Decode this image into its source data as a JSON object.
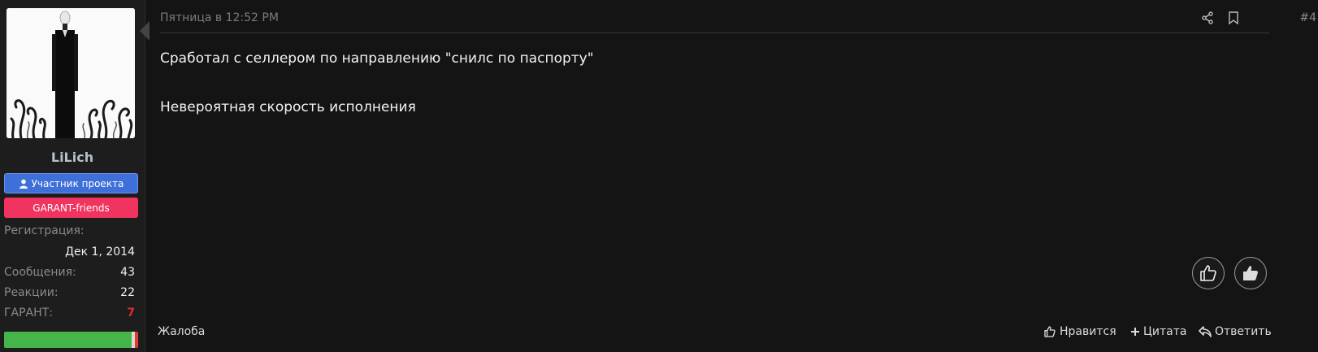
{
  "user": {
    "name": "LiLich",
    "banners": {
      "member_label": "Участник проекта",
      "garant_label": "GARANT-friends"
    },
    "stats": {
      "registration_label": "Регистрация:",
      "registration_value": "Дек 1, 2014",
      "messages_label": "Сообщения:",
      "messages_value": "43",
      "reactions_label": "Реакции:",
      "reactions_value": "22",
      "garant_label": "ГАРАНТ:",
      "garant_value": "7"
    },
    "reputation_fill_percent": 95
  },
  "post": {
    "timestamp": "Пятница в 12:52 PM",
    "number": "#4",
    "paragraphs": [
      "Сработал с селлером по направлению \"снилс по паспорту\"",
      "Невероятная скорость исполнения"
    ]
  },
  "actions": {
    "report_label": "Жалоба",
    "like_label": "Нравится",
    "quote_label": "Цитата",
    "reply_label": "Ответить"
  },
  "icons": {
    "share": "share-icon",
    "bookmark": "bookmark-icon",
    "thumbs_up": "thumbs-up-icon"
  },
  "colors": {
    "member_banner": "#3f6fd8",
    "garant_banner": "#f0335f",
    "reputation_fill": "#45b54a",
    "garant_value": "#e52a2a"
  }
}
